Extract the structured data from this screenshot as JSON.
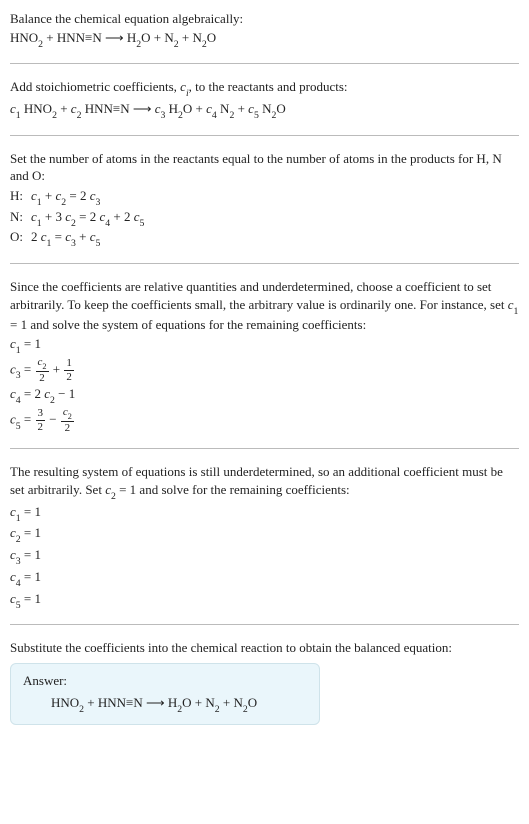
{
  "title": "Balance the chemical equation algebraically:",
  "eq_unbalanced": "HNO₂ + HNN≡N ⟶ H₂O + N₂ + N₂O",
  "stoich_intro": "Add stoichiometric coefficients, cᵢ, to the reactants and products:",
  "eq_stoich": "c₁ HNO₂ + c₂ HNN≡N ⟶ c₃ H₂O + c₄ N₂ + c₅ N₂O",
  "atoms_intro": "Set the number of atoms in the reactants equal to the number of atoms in the products for H, N and O:",
  "atom_rows": [
    {
      "label": "H:",
      "eq": "c₁ + c₂ = 2 c₃"
    },
    {
      "label": "N:",
      "eq": "c₁ + 3 c₂ = 2 c₄ + 2 c₅"
    },
    {
      "label": "O:",
      "eq": "2 c₁ = c₃ + c₅"
    }
  ],
  "underdet_intro": "Since the coefficients are relative quantities and underdetermined, choose a coefficient to set arbitrarily. To keep the coefficients small, the arbitrary value is ordinarily one. For instance, set c₁ = 1 and solve the system of equations for the remaining coefficients:",
  "first_solve": {
    "c1": "c₁ = 1",
    "c3_prefix": "c₃ = ",
    "c3_frac1_num": "c₂",
    "c3_frac1_den": "2",
    "c3_mid": " + ",
    "c3_frac2_num": "1",
    "c3_frac2_den": "2",
    "c4": "c₄ = 2 c₂ − 1",
    "c5_prefix": "c₅ = ",
    "c5_frac1_num": "3",
    "c5_frac1_den": "2",
    "c5_mid": " − ",
    "c5_frac2_num": "c₂",
    "c5_frac2_den": "2"
  },
  "second_intro": "The resulting system of equations is still underdetermined, so an additional coefficient must be set arbitrarily. Set c₂ = 1 and solve for the remaining coefficients:",
  "second_solve": [
    "c₁ = 1",
    "c₂ = 1",
    "c₃ = 1",
    "c₄ = 1",
    "c₅ = 1"
  ],
  "final_intro": "Substitute the coefficients into the chemical reaction to obtain the balanced equation:",
  "answer_label": "Answer:",
  "answer_eq": "HNO₂ + HNN≡N ⟶ H₂O + N₂ + N₂O"
}
